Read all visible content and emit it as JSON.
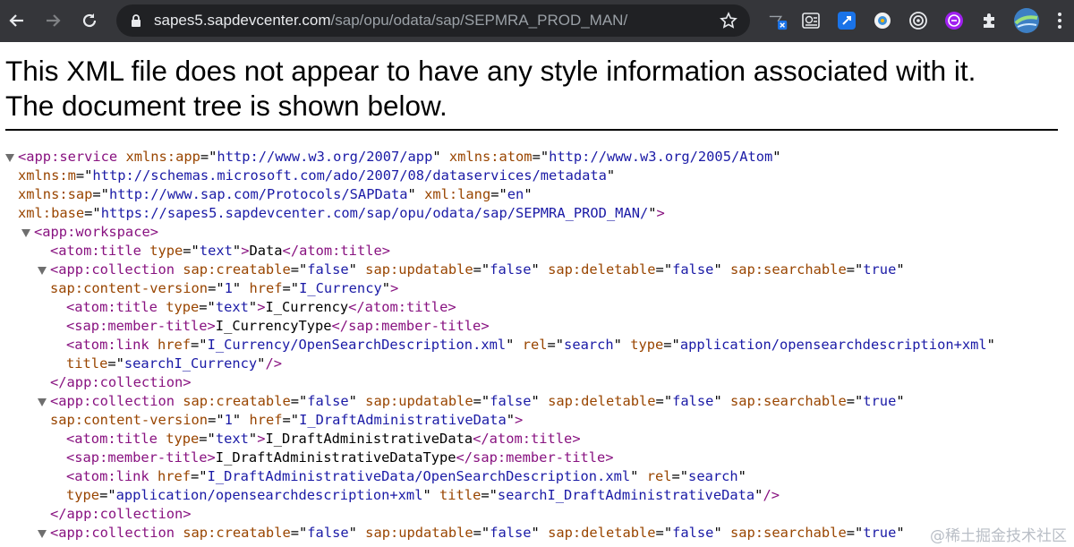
{
  "browser": {
    "url_host": "sapes5.sapdevcenter.com",
    "url_path": "/sap/opu/odata/sap/SEPMRA_PROD_MAN/",
    "icons": [
      "back-icon",
      "forward-icon",
      "reload-icon",
      "lock-icon",
      "bookmark-star-icon",
      "extension-x-icon",
      "extension-news-icon",
      "extension-blue-square-icon",
      "extension-camera-icon",
      "extension-target-icon",
      "extension-purple-icon",
      "puzzle-icon",
      "profile-avatar",
      "more-menu-icon"
    ]
  },
  "banner": {
    "line1": "This XML file does not appear to have any style information associated with it.",
    "line2": "The document tree is shown below."
  },
  "tree": {
    "lines": [
      [
        [
          "tag",
          "<app:service "
        ],
        [
          "an",
          "xmlns:app"
        ],
        [
          "tx",
          "=\""
        ],
        [
          "av",
          "http://www.w3.org/2007/app"
        ],
        [
          "tx",
          "\" "
        ],
        [
          "an",
          "xmlns:atom"
        ],
        [
          "tx",
          "=\""
        ],
        [
          "av",
          "http://www.w3.org/2005/Atom"
        ],
        [
          "tx",
          "\""
        ]
      ],
      [
        [
          "an",
          "xmlns:m"
        ],
        [
          "tx",
          "=\""
        ],
        [
          "av",
          "http://schemas.microsoft.com/ado/2007/08/dataservices/metadata"
        ],
        [
          "tx",
          "\""
        ]
      ],
      [
        [
          "an",
          "xmlns:sap"
        ],
        [
          "tx",
          "=\""
        ],
        [
          "av",
          "http://www.sap.com/Protocols/SAPData"
        ],
        [
          "tx",
          "\" "
        ],
        [
          "an",
          "xml:lang"
        ],
        [
          "tx",
          "=\""
        ],
        [
          "av",
          "en"
        ],
        [
          "tx",
          "\""
        ]
      ],
      [
        [
          "an",
          "xml:base"
        ],
        [
          "tx",
          "=\""
        ],
        [
          "av",
          "https://sapes5.sapdevcenter.com/sap/opu/odata/sap/SEPMRA_PROD_MAN/"
        ],
        [
          "tx",
          "\""
        ],
        [
          "tag",
          ">"
        ]
      ],
      [
        [
          "tag",
          "<app:workspace>"
        ]
      ],
      [
        [
          "tag",
          "<atom:title "
        ],
        [
          "an",
          "type"
        ],
        [
          "tx",
          "=\""
        ],
        [
          "av",
          "text"
        ],
        [
          "tx",
          "\""
        ],
        [
          "tag",
          ">"
        ],
        [
          "tx",
          "Data"
        ],
        [
          "tag",
          "</atom:title>"
        ]
      ],
      [
        [
          "tag",
          "<app:collection "
        ],
        [
          "an",
          "sap:creatable"
        ],
        [
          "tx",
          "=\""
        ],
        [
          "av",
          "false"
        ],
        [
          "tx",
          "\" "
        ],
        [
          "an",
          "sap:updatable"
        ],
        [
          "tx",
          "=\""
        ],
        [
          "av",
          "false"
        ],
        [
          "tx",
          "\" "
        ],
        [
          "an",
          "sap:deletable"
        ],
        [
          "tx",
          "=\""
        ],
        [
          "av",
          "false"
        ],
        [
          "tx",
          "\" "
        ],
        [
          "an",
          "sap:searchable"
        ],
        [
          "tx",
          "=\""
        ],
        [
          "av",
          "true"
        ],
        [
          "tx",
          "\""
        ]
      ],
      [
        [
          "an",
          "sap:content-version"
        ],
        [
          "tx",
          "=\""
        ],
        [
          "av",
          "1"
        ],
        [
          "tx",
          "\" "
        ],
        [
          "an",
          "href"
        ],
        [
          "tx",
          "=\""
        ],
        [
          "av",
          "I_Currency"
        ],
        [
          "tx",
          "\""
        ],
        [
          "tag",
          ">"
        ]
      ],
      [
        [
          "tag",
          "<atom:title "
        ],
        [
          "an",
          "type"
        ],
        [
          "tx",
          "=\""
        ],
        [
          "av",
          "text"
        ],
        [
          "tx",
          "\""
        ],
        [
          "tag",
          ">"
        ],
        [
          "tx",
          "I_Currency"
        ],
        [
          "tag",
          "</atom:title>"
        ]
      ],
      [
        [
          "tag",
          "<sap:member-title>"
        ],
        [
          "tx",
          "I_CurrencyType"
        ],
        [
          "tag",
          "</sap:member-title>"
        ]
      ],
      [
        [
          "tag",
          "<atom:link "
        ],
        [
          "an",
          "href"
        ],
        [
          "tx",
          "=\""
        ],
        [
          "av",
          "I_Currency/OpenSearchDescription.xml"
        ],
        [
          "tx",
          "\" "
        ],
        [
          "an",
          "rel"
        ],
        [
          "tx",
          "=\""
        ],
        [
          "av",
          "search"
        ],
        [
          "tx",
          "\" "
        ],
        [
          "an",
          "type"
        ],
        [
          "tx",
          "=\""
        ],
        [
          "av",
          "application/opensearchdescription+xml"
        ],
        [
          "tx",
          "\""
        ]
      ],
      [
        [
          "an",
          "title"
        ],
        [
          "tx",
          "=\""
        ],
        [
          "av",
          "searchI_Currency"
        ],
        [
          "tx",
          "\""
        ],
        [
          "tag",
          "/>"
        ]
      ],
      [
        [
          "tag",
          "</app:collection>"
        ]
      ],
      [
        [
          "tag",
          "<app:collection "
        ],
        [
          "an",
          "sap:creatable"
        ],
        [
          "tx",
          "=\""
        ],
        [
          "av",
          "false"
        ],
        [
          "tx",
          "\" "
        ],
        [
          "an",
          "sap:updatable"
        ],
        [
          "tx",
          "=\""
        ],
        [
          "av",
          "false"
        ],
        [
          "tx",
          "\" "
        ],
        [
          "an",
          "sap:deletable"
        ],
        [
          "tx",
          "=\""
        ],
        [
          "av",
          "false"
        ],
        [
          "tx",
          "\" "
        ],
        [
          "an",
          "sap:searchable"
        ],
        [
          "tx",
          "=\""
        ],
        [
          "av",
          "true"
        ],
        [
          "tx",
          "\""
        ]
      ],
      [
        [
          "an",
          "sap:content-version"
        ],
        [
          "tx",
          "=\""
        ],
        [
          "av",
          "1"
        ],
        [
          "tx",
          "\" "
        ],
        [
          "an",
          "href"
        ],
        [
          "tx",
          "=\""
        ],
        [
          "av",
          "I_DraftAdministrativeData"
        ],
        [
          "tx",
          "\""
        ],
        [
          "tag",
          ">"
        ]
      ],
      [
        [
          "tag",
          "<atom:title "
        ],
        [
          "an",
          "type"
        ],
        [
          "tx",
          "=\""
        ],
        [
          "av",
          "text"
        ],
        [
          "tx",
          "\""
        ],
        [
          "tag",
          ">"
        ],
        [
          "tx",
          "I_DraftAdministrativeData"
        ],
        [
          "tag",
          "</atom:title>"
        ]
      ],
      [
        [
          "tag",
          "<sap:member-title>"
        ],
        [
          "tx",
          "I_DraftAdministrativeDataType"
        ],
        [
          "tag",
          "</sap:member-title>"
        ]
      ],
      [
        [
          "tag",
          "<atom:link "
        ],
        [
          "an",
          "href"
        ],
        [
          "tx",
          "=\""
        ],
        [
          "av",
          "I_DraftAdministrativeData/OpenSearchDescription.xml"
        ],
        [
          "tx",
          "\" "
        ],
        [
          "an",
          "rel"
        ],
        [
          "tx",
          "=\""
        ],
        [
          "av",
          "search"
        ],
        [
          "tx",
          "\""
        ]
      ],
      [
        [
          "an",
          "type"
        ],
        [
          "tx",
          "=\""
        ],
        [
          "av",
          "application/opensearchdescription+xml"
        ],
        [
          "tx",
          "\" "
        ],
        [
          "an",
          "title"
        ],
        [
          "tx",
          "=\""
        ],
        [
          "av",
          "searchI_DraftAdministrativeData"
        ],
        [
          "tx",
          "\""
        ],
        [
          "tag",
          "/>"
        ]
      ],
      [
        [
          "tag",
          "</app:collection>"
        ]
      ],
      [
        [
          "tag",
          "<app:collection "
        ],
        [
          "an",
          "sap:creatable"
        ],
        [
          "tx",
          "=\""
        ],
        [
          "av",
          "false"
        ],
        [
          "tx",
          "\" "
        ],
        [
          "an",
          "sap:updatable"
        ],
        [
          "tx",
          "=\""
        ],
        [
          "av",
          "false"
        ],
        [
          "tx",
          "\" "
        ],
        [
          "an",
          "sap:deletable"
        ],
        [
          "tx",
          "=\""
        ],
        [
          "av",
          "false"
        ],
        [
          "tx",
          "\" "
        ],
        [
          "an",
          "sap:searchable"
        ],
        [
          "tx",
          "=\""
        ],
        [
          "av",
          "true"
        ],
        [
          "tx",
          "\""
        ]
      ]
    ]
  },
  "watermark": "@稀土掘金技术社区"
}
